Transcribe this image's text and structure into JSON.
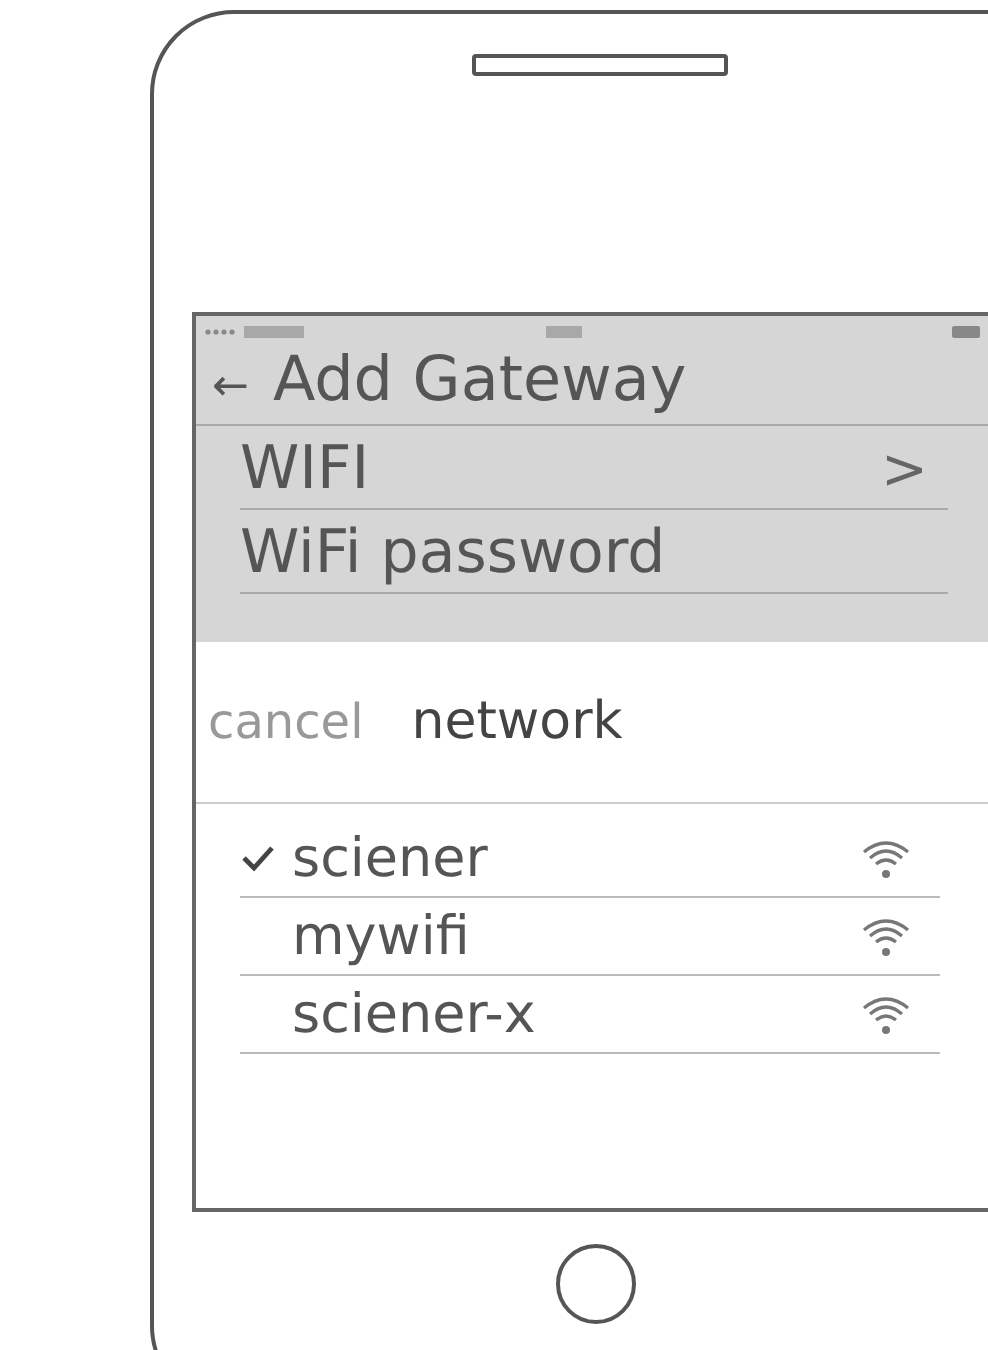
{
  "header": {
    "back": "←",
    "title": "Add Gateway"
  },
  "settings": [
    {
      "label": "WIFI",
      "chevron": ">"
    },
    {
      "label": "WiFi password"
    }
  ],
  "sheet": {
    "cancel": "cancel",
    "title": "network",
    "networks": [
      {
        "name": "sciener",
        "selected": true
      },
      {
        "name": "mywifi",
        "selected": false
      },
      {
        "name": "sciener-x",
        "selected": false
      }
    ]
  }
}
